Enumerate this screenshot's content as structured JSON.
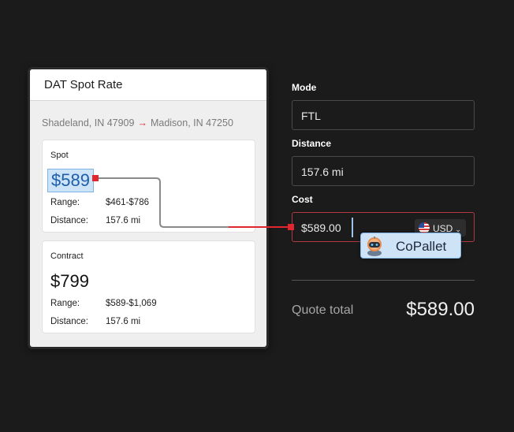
{
  "dat_card": {
    "title": "DAT Spot Rate",
    "route_origin": "Shadeland, IN 47909",
    "route_destination": "Madison, IN 47250",
    "spot": {
      "label": "Spot",
      "price": "$589",
      "range_label": "Range:",
      "range_value": "$461-$786",
      "distance_label": "Distance:",
      "distance_value": "157.6 mi"
    },
    "contract": {
      "label": "Contract",
      "price": "$799",
      "range_label": "Range:",
      "range_value": "$589-$1,069",
      "distance_label": "Distance:",
      "distance_value": "157.6 mi"
    }
  },
  "form": {
    "mode_label": "Mode",
    "mode_value": "FTL",
    "distance_label": "Distance",
    "distance_value": "157.6 mi",
    "cost_label": "Cost",
    "cost_value": "$589.00",
    "currency": "USD"
  },
  "copallet": {
    "label": "CoPallet",
    "icon": "robot-avatar-icon"
  },
  "quote": {
    "label": "Quote total",
    "value": "$589.00"
  },
  "colors": {
    "background": "#1c1b1b",
    "connector_red": "#e2262f",
    "highlight_blue": "#cde3f7"
  }
}
